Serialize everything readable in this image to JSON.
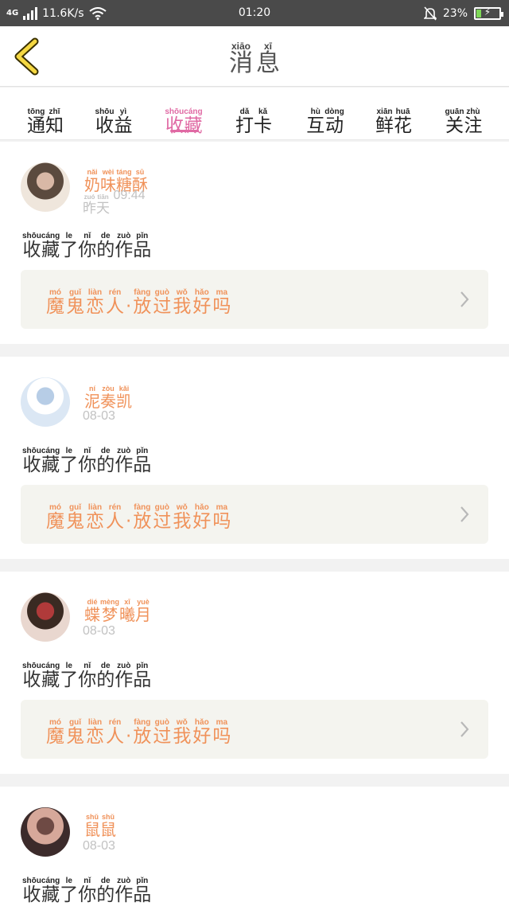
{
  "status_bar": {
    "network": "4G",
    "speed": "11.6K/s",
    "time": "01:20",
    "battery": "23%",
    "battery_level": 0.23
  },
  "header": {
    "title": [
      {
        "py": "xiāo",
        "hz": "消"
      },
      {
        "py": "xī",
        "hz": "息"
      }
    ]
  },
  "tabs": [
    {
      "chars": [
        {
          "py": "tōng",
          "hz": "通"
        },
        {
          "py": "zhī",
          "hz": "知"
        }
      ]
    },
    {
      "chars": [
        {
          "py": "shōu",
          "hz": "收"
        },
        {
          "py": "yì",
          "hz": "益"
        }
      ]
    },
    {
      "chars": [
        {
          "py": "shōu",
          "hz": "收"
        },
        {
          "py": "cáng",
          "hz": "藏"
        }
      ],
      "active": true
    },
    {
      "chars": [
        {
          "py": "dǎ",
          "hz": "打"
        },
        {
          "py": "kǎ",
          "hz": "卡"
        }
      ]
    },
    {
      "chars": [
        {
          "py": "hù",
          "hz": "互"
        },
        {
          "py": "dòng",
          "hz": "动"
        }
      ]
    },
    {
      "chars": [
        {
          "py": "xiān",
          "hz": "鲜"
        },
        {
          "py": "huā",
          "hz": "花"
        }
      ]
    },
    {
      "chars": [
        {
          "py": "guān",
          "hz": "关"
        },
        {
          "py": "zhù",
          "hz": "注"
        }
      ]
    }
  ],
  "messages": [
    {
      "username": [
        {
          "py": "nǎi",
          "hz": "奶"
        },
        {
          "py": "wèi",
          "hz": "味"
        },
        {
          "py": "táng",
          "hz": "糖"
        },
        {
          "py": "sū",
          "hz": "酥"
        }
      ],
      "time_ruby": [
        {
          "py": "zuó",
          "hz": "昨"
        },
        {
          "py": "tiān",
          "hz": "天"
        }
      ],
      "time": "09:44",
      "action": [
        {
          "py": "shōu",
          "hz": "收"
        },
        {
          "py": "cáng",
          "hz": "藏"
        },
        {
          "py": "le",
          "hz": "了"
        },
        {
          "py": "nǐ",
          "hz": "你"
        },
        {
          "py": "de",
          "hz": "的"
        },
        {
          "py": "zuò",
          "hz": "作"
        },
        {
          "py": "pǐn",
          "hz": "品"
        }
      ],
      "work": [
        {
          "py": "mó",
          "hz": "魔"
        },
        {
          "py": "guǐ",
          "hz": "鬼"
        },
        {
          "py": "liàn",
          "hz": "恋"
        },
        {
          "py": "rén",
          "hz": "人"
        },
        {
          "py": "",
          "hz": "·"
        },
        {
          "py": "fàng",
          "hz": "放"
        },
        {
          "py": "guò",
          "hz": "过"
        },
        {
          "py": "wǒ",
          "hz": "我"
        },
        {
          "py": "hǎo",
          "hz": "好"
        },
        {
          "py": "ma",
          "hz": "吗"
        }
      ],
      "avatar_colors": [
        "#efe6dc",
        "#5b4a3e",
        "#d9b8a6"
      ]
    },
    {
      "username": [
        {
          "py": "ní",
          "hz": "泥"
        },
        {
          "py": "zòu",
          "hz": "奏"
        },
        {
          "py": "kǎi",
          "hz": "凯"
        }
      ],
      "time": "08-03",
      "action": [
        {
          "py": "shōu",
          "hz": "收"
        },
        {
          "py": "cáng",
          "hz": "藏"
        },
        {
          "py": "le",
          "hz": "了"
        },
        {
          "py": "nǐ",
          "hz": "你"
        },
        {
          "py": "de",
          "hz": "的"
        },
        {
          "py": "zuò",
          "hz": "作"
        },
        {
          "py": "pǐn",
          "hz": "品"
        }
      ],
      "work": [
        {
          "py": "mó",
          "hz": "魔"
        },
        {
          "py": "guǐ",
          "hz": "鬼"
        },
        {
          "py": "liàn",
          "hz": "恋"
        },
        {
          "py": "rén",
          "hz": "人"
        },
        {
          "py": "",
          "hz": "·"
        },
        {
          "py": "fàng",
          "hz": "放"
        },
        {
          "py": "guò",
          "hz": "过"
        },
        {
          "py": "wǒ",
          "hz": "我"
        },
        {
          "py": "hǎo",
          "hz": "好"
        },
        {
          "py": "ma",
          "hz": "吗"
        }
      ],
      "avatar_colors": [
        "#dbe7f4",
        "#ffffff",
        "#b7cde6"
      ]
    },
    {
      "username": [
        {
          "py": "dié",
          "hz": "蝶"
        },
        {
          "py": "mèng",
          "hz": "梦"
        },
        {
          "py": "xī",
          "hz": "曦"
        },
        {
          "py": "yuè",
          "hz": "月"
        }
      ],
      "time": "08-03",
      "action": [
        {
          "py": "shōu",
          "hz": "收"
        },
        {
          "py": "cáng",
          "hz": "藏"
        },
        {
          "py": "le",
          "hz": "了"
        },
        {
          "py": "nǐ",
          "hz": "你"
        },
        {
          "py": "de",
          "hz": "的"
        },
        {
          "py": "zuò",
          "hz": "作"
        },
        {
          "py": "pǐn",
          "hz": "品"
        }
      ],
      "work": [
        {
          "py": "mó",
          "hz": "魔"
        },
        {
          "py": "guǐ",
          "hz": "鬼"
        },
        {
          "py": "liàn",
          "hz": "恋"
        },
        {
          "py": "rén",
          "hz": "人"
        },
        {
          "py": "",
          "hz": "·"
        },
        {
          "py": "fàng",
          "hz": "放"
        },
        {
          "py": "guò",
          "hz": "过"
        },
        {
          "py": "wǒ",
          "hz": "我"
        },
        {
          "py": "hǎo",
          "hz": "好"
        },
        {
          "py": "ma",
          "hz": "吗"
        }
      ],
      "avatar_colors": [
        "#e9d7cf",
        "#3a2a22",
        "#b03a3a"
      ]
    },
    {
      "username": [
        {
          "py": "shǔ",
          "hz": "鼠"
        },
        {
          "py": "shǔ",
          "hz": "鼠"
        }
      ],
      "time": "08-03",
      "action": [
        {
          "py": "shōu",
          "hz": "收"
        },
        {
          "py": "cáng",
          "hz": "藏"
        },
        {
          "py": "le",
          "hz": "了"
        },
        {
          "py": "nǐ",
          "hz": "你"
        },
        {
          "py": "de",
          "hz": "的"
        },
        {
          "py": "zuò",
          "hz": "作"
        },
        {
          "py": "pǐn",
          "hz": "品"
        }
      ],
      "avatar_colors": [
        "#3c2b2b",
        "#d6a89a",
        "#6e4a44"
      ]
    }
  ]
}
